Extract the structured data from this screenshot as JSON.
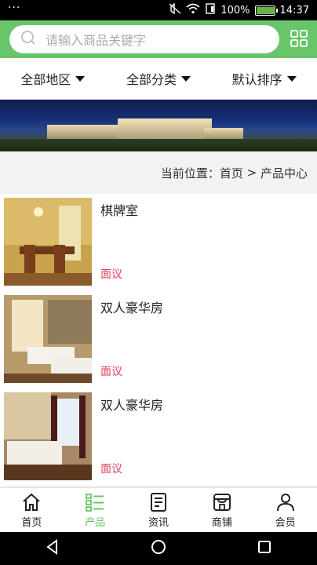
{
  "status_bar": {
    "signal_dots": "···",
    "battery_percent": "100%",
    "time": "14:37",
    "battery_level": 1.0
  },
  "search": {
    "placeholder": "请输入商品关键字"
  },
  "filters": [
    {
      "label": "全部地区"
    },
    {
      "label": "全部分类"
    },
    {
      "label": "默认排序"
    }
  ],
  "breadcrumb": {
    "label": "当前位置：",
    "home": "首页",
    "separator": " > ",
    "current": "产品中心"
  },
  "products": [
    {
      "name": "棋牌室",
      "price": "面议"
    },
    {
      "name": "双人豪华房",
      "price": "面议"
    },
    {
      "name": "双人豪华房",
      "price": "面议"
    }
  ],
  "tabs": [
    {
      "label": "首页",
      "icon": "home-icon"
    },
    {
      "label": "产品",
      "icon": "product-list-icon",
      "active": true
    },
    {
      "label": "资讯",
      "icon": "news-icon"
    },
    {
      "label": "商铺",
      "icon": "shop-icon"
    },
    {
      "label": "会员",
      "icon": "member-icon"
    }
  ],
  "colors": {
    "accent": "#69c56a",
    "price": "#e0405b"
  }
}
